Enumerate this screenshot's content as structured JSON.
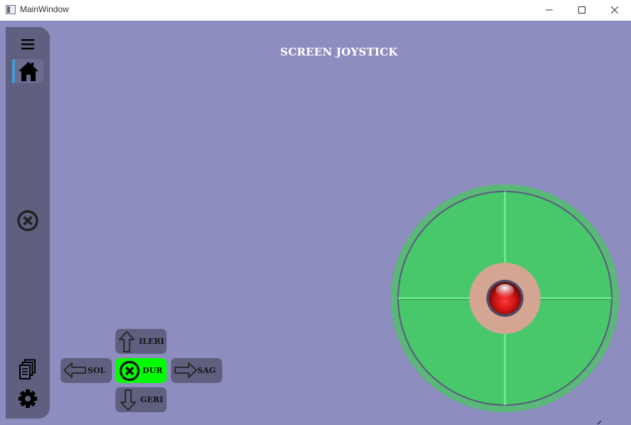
{
  "window": {
    "title": "MainWindow",
    "controls": [
      "minimize-icon",
      "maximize-icon",
      "close-icon"
    ]
  },
  "sidebar": {
    "items": [
      {
        "name": "menu",
        "icon": "hamburger-icon"
      },
      {
        "name": "home",
        "icon": "home-icon",
        "active": true
      },
      {
        "name": "stop",
        "icon": "close-circle-icon"
      },
      {
        "name": "documents",
        "icon": "documents-icon"
      },
      {
        "name": "settings",
        "icon": "gear-icon"
      }
    ]
  },
  "page": {
    "title": "SCREEN JOYSTICK"
  },
  "controls": {
    "forward_label": "ILERI",
    "left_label": "SOL",
    "stop_label": "DUR",
    "right_label": "SAG",
    "backward_label": "GERI"
  },
  "joystick": {
    "knob_offset_x": 0,
    "knob_offset_y": 0
  },
  "colors": {
    "background": "#8d8ebf",
    "sidebar": "#5f5f7f",
    "button": "#5f5f80",
    "stop_active": "#00ff00",
    "joystick_base": "#48c86a",
    "joystick_outer": "#5ab878",
    "crosshair": "#66ee88",
    "deadzone": "#d4a592",
    "knob": "#d11515",
    "active_indicator": "#4a9ad8"
  }
}
